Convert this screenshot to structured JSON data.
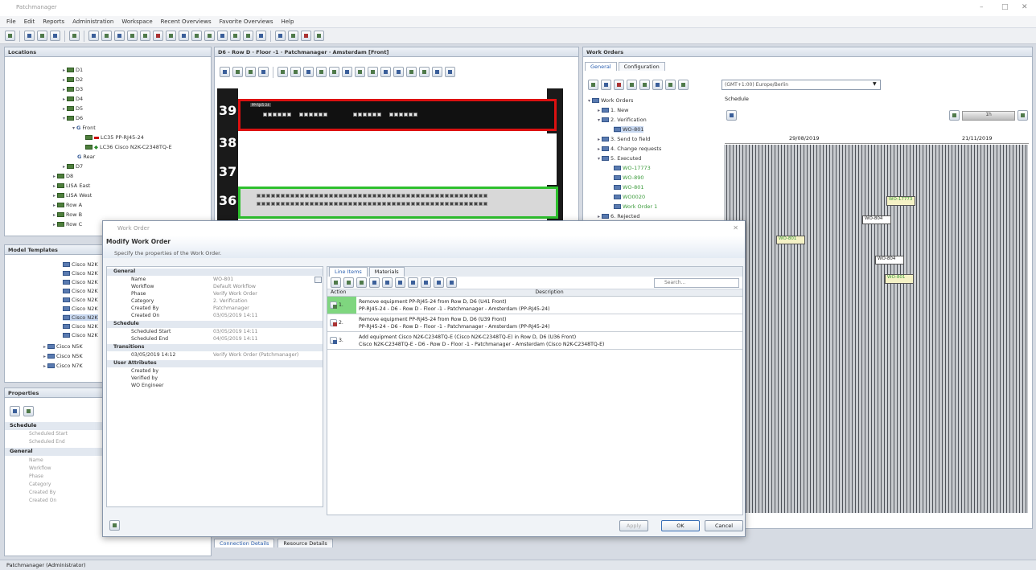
{
  "app": {
    "title": "Patchmanager",
    "window_controls": [
      "–",
      "□",
      "✕"
    ]
  },
  "menu": [
    "File",
    "Edit",
    "Reports",
    "Administration",
    "Workspace",
    "Recent Overviews",
    "Favorite Overviews",
    "Help"
  ],
  "locations_panel": {
    "title": "Locations",
    "tree": [
      "D1",
      "D2",
      "D3",
      "D4",
      "D5",
      "D6",
      "Front",
      "LC35 PP-RJ45-24",
      "LC36 Cisco N2K-C2348TQ-E",
      "Rear",
      "D7",
      "D8",
      "LISA East",
      "LISA West",
      "Row A",
      "Row B",
      "Row C"
    ]
  },
  "model_templates_panel": {
    "title": "Model Templates",
    "items": [
      "Cisco N2K",
      "Cisco N2K",
      "Cisco N2K",
      "Cisco N2K",
      "Cisco N2K",
      "Cisco N2K",
      "Cisco N2K",
      "Cisco N2K",
      "Cisco N2K",
      "Cisco N5K",
      "Cisco N5K",
      "Cisco N7K"
    ]
  },
  "properties_panel": {
    "title": "Properties",
    "sections": [
      {
        "name": "Schedule",
        "fields": [
          "Scheduled Start",
          "Scheduled End"
        ]
      },
      {
        "name": "General",
        "fields": [
          "Name",
          "Workflow",
          "Phase",
          "Category",
          "Created By",
          "Created On"
        ]
      }
    ]
  },
  "rack_view": {
    "tab_title": "D6 - Row D · Floor -1 · Patchmanager · Amsterdam [Front]",
    "units": [
      "39",
      "38",
      "37",
      "36"
    ],
    "label_red": "PP-RJ45-24"
  },
  "work_orders_panel": {
    "tab_title": "Work Orders",
    "tabs": [
      "General",
      "Configuration"
    ],
    "timezone": "(GMT+1:00) Europe/Berlin",
    "tree": [
      "Work Orders",
      "1. New",
      "2. Verification",
      "WO-801",
      "3. Send to field",
      "4. Change requests",
      "5. Executed",
      "WO-17773",
      "WO-890",
      "WO-801",
      "WO0020",
      "Work Order 1",
      "6. Rejected"
    ],
    "schedule": {
      "label": "Schedule",
      "zoom": "1h",
      "date_left": "29/08/2019",
      "date_right": "21/11/2019",
      "tags": [
        "WO-801",
        "WO-804",
        "WO-17773",
        "WO-804",
        "WO-801"
      ]
    }
  },
  "dialog": {
    "title": "Work Order",
    "heading": "Modify Work Order",
    "subheading": "Specify the properties of the Work Order.",
    "properties": [
      {
        "type": "section",
        "label": "General"
      },
      {
        "label": "Name",
        "value": "WO-801"
      },
      {
        "label": "Workflow",
        "value": "Default Workflow"
      },
      {
        "label": "Phase",
        "value": "Verify Work Order"
      },
      {
        "label": "Category",
        "value": "2. Verification"
      },
      {
        "label": "Created By",
        "value": "Patchmanager"
      },
      {
        "label": "Created On",
        "value": "03/05/2019 14:11"
      },
      {
        "type": "section",
        "label": "Schedule"
      },
      {
        "label": "Scheduled Start",
        "value": "03/05/2019 14:11"
      },
      {
        "label": "Scheduled End",
        "value": "04/05/2019 14:11"
      },
      {
        "type": "section",
        "label": "Transitions"
      },
      {
        "label": "03/05/2019 14:12",
        "value": "Verify Work Order (Patchmanager)"
      },
      {
        "type": "section",
        "label": "User Attributes"
      },
      {
        "label": "Created by",
        "value": ""
      },
      {
        "label": "Verified by",
        "value": ""
      },
      {
        "label": "WO Engineer",
        "value": ""
      }
    ],
    "tabs": [
      "Line Items",
      "Materials"
    ],
    "search_placeholder": "Search...",
    "columns": [
      "Action",
      "Description"
    ],
    "line_items": [
      {
        "num": "1.",
        "line1": "Remove equipment PP-RJ45-24 from Row D, D6 (U41 Front)",
        "line2": "PP-RJ45-24 - D6 - Row D - Floor -1 - Patchmanager - Amsterdam (PP-RJ45-24)"
      },
      {
        "num": "2.",
        "line1": "Remove equipment PP-RJ45-24 from Row D, D6 (U39 Front)",
        "line2": "PP-RJ45-24 - D6 - Row D - Floor -1 - Patchmanager - Amsterdam (PP-RJ45-24)"
      },
      {
        "num": "3.",
        "line1": "Add equipment Cisco N2K-C2348TQ-E (Cisco N2K-C2348TQ-E) in Row D, D6 (U36 Front)",
        "line2": "Cisco N2K-C2348TQ-E - D6 - Row D - Floor -1 - Patchmanager - Amsterdam (Cisco N2K-C2348TQ-E)"
      }
    ],
    "buttons": {
      "apply": "Apply",
      "ok": "OK",
      "cancel": "Cancel"
    }
  },
  "bottom_tabs": [
    "Connection Details",
    "Resource Details"
  ],
  "status": {
    "user": "Patchmanager (Administrator)"
  },
  "colors": {
    "rack_highlight_red": "#d11111",
    "rack_highlight_green": "#2ec02e",
    "selected_row": "#7fd67f"
  }
}
